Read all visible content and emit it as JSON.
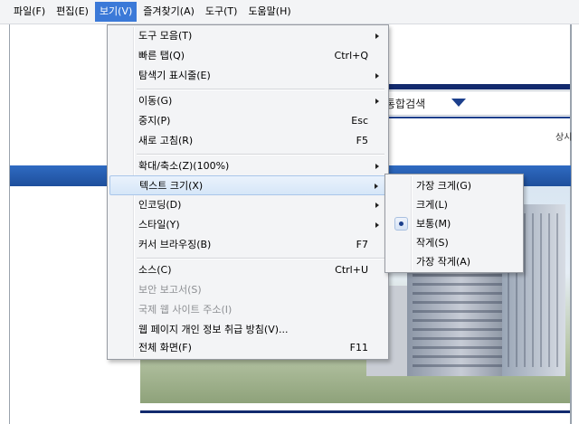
{
  "menubar": {
    "items": [
      "파일(F)",
      "편집(E)",
      "보기(V)",
      "즐겨찾기(A)",
      "도구(T)",
      "도움말(H)"
    ]
  },
  "page": {
    "search_label": "통합검색",
    "cut_text": "상시"
  },
  "view_menu": {
    "items": [
      {
        "label": "도구 모음(T)",
        "shortcut": ""
      },
      {
        "label": "빠른 탭(Q)",
        "shortcut": "Ctrl+Q"
      },
      {
        "label": "탐색기 표시줄(E)",
        "shortcut": ""
      },
      {
        "label": "이동(G)",
        "shortcut": ""
      },
      {
        "label": "중지(P)",
        "shortcut": "Esc"
      },
      {
        "label": "새로 고침(R)",
        "shortcut": "F5"
      },
      {
        "label": "확대/축소(Z)(100%)",
        "shortcut": ""
      },
      {
        "label": "텍스트 크기(X)",
        "shortcut": ""
      },
      {
        "label": "인코딩(D)",
        "shortcut": ""
      },
      {
        "label": "스타일(Y)",
        "shortcut": ""
      },
      {
        "label": "커서 브라우징(B)",
        "shortcut": "F7"
      },
      {
        "label": "소스(C)",
        "shortcut": "Ctrl+U"
      },
      {
        "label": "보안 보고서(S)",
        "shortcut": ""
      },
      {
        "label": "국제 웹 사이트 주소(I)",
        "shortcut": ""
      },
      {
        "label": "웹 페이지 개인 정보 취급 방침(V)...",
        "shortcut": ""
      },
      {
        "label": "전체 화면(F)",
        "shortcut": "F11"
      }
    ]
  },
  "text_size_submenu": {
    "items": [
      "가장 크게(G)",
      "크게(L)",
      "보통(M)",
      "작게(S)",
      "가장 작게(A)"
    ],
    "selected": "보통(M)"
  },
  "colors": {
    "menu_bg": "#f3f4f6",
    "highlight_border": "#a9c6ea",
    "active_menubar": "#3b79d8",
    "navy": "#122a6e"
  }
}
